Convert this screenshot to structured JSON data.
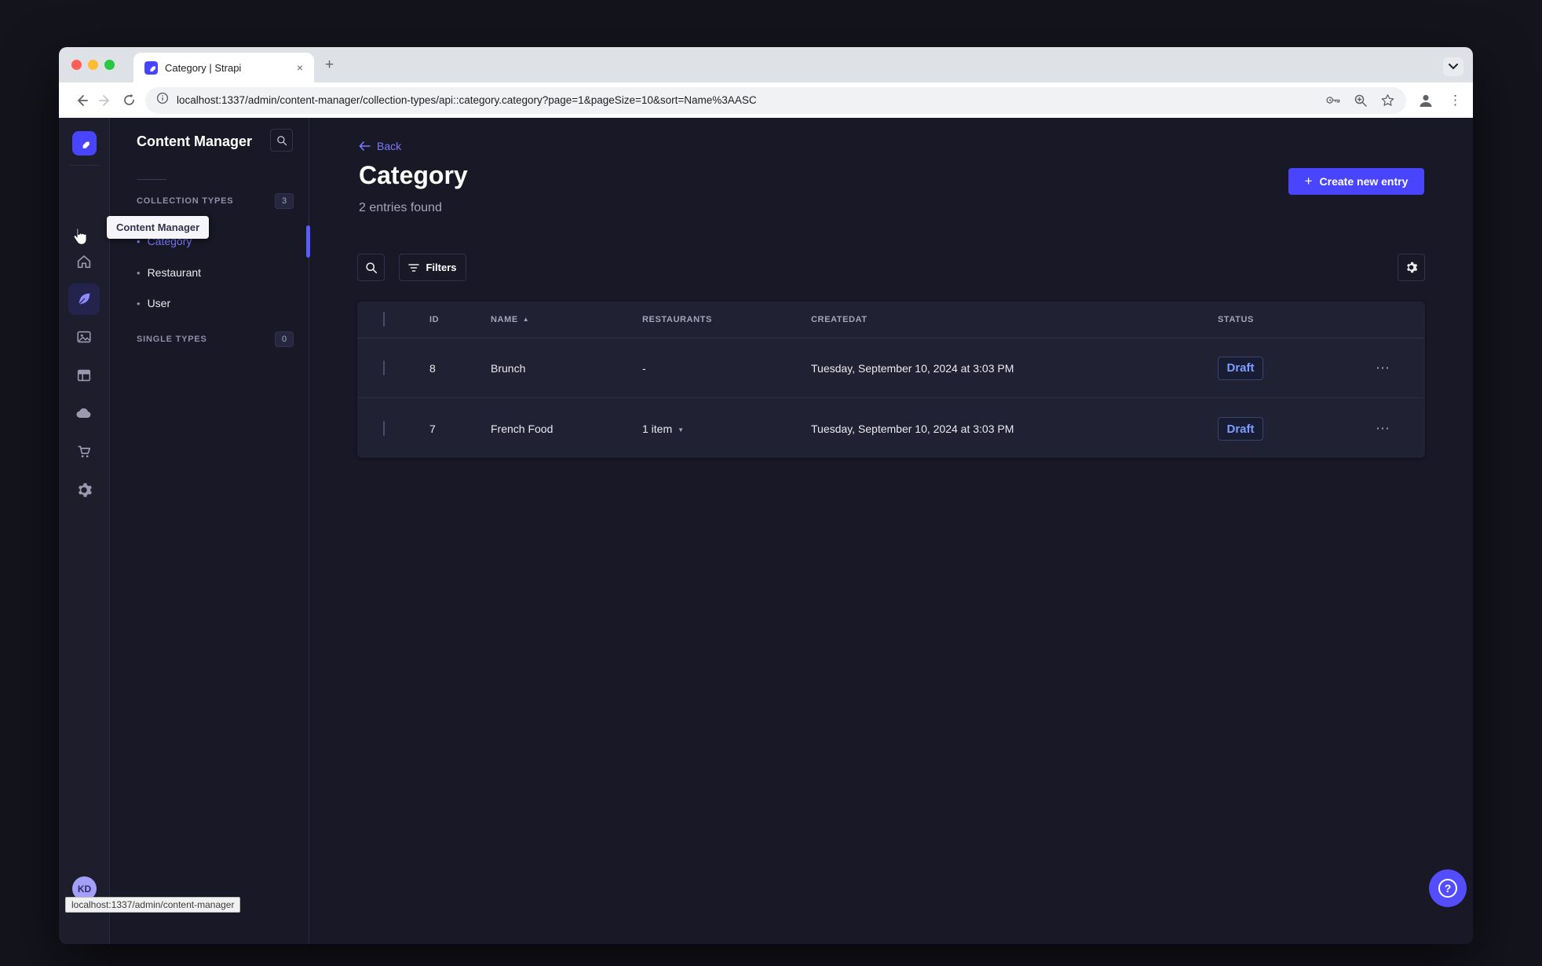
{
  "colors": {
    "primary": "#4945ff",
    "active_link": "#7b79ff",
    "draft_text": "#7f9cff"
  },
  "icons": {
    "plus": "+",
    "close": "×",
    "bullet": "•",
    "sort_asc": "▲",
    "caret_down": "▼",
    "more": "⋯",
    "menu": "⋮",
    "question": "?"
  },
  "browser": {
    "tab_title": "Category | Strapi",
    "url": "localhost:1337/admin/content-manager/collection-types/api::category.category?page=1&pageSize=10&sort=Name%3AASC",
    "status_tooltip": "localhost:1337/admin/content-manager"
  },
  "sidebar": {
    "avatar_initials": "KD",
    "tooltip": "Content Manager"
  },
  "subnav": {
    "title": "Content Manager",
    "collection_types": {
      "label": "COLLECTION TYPES",
      "count": "3",
      "items": [
        {
          "label": "Category"
        },
        {
          "label": "Restaurant"
        },
        {
          "label": "User"
        }
      ]
    },
    "single_types": {
      "label": "SINGLE TYPES",
      "count": "0"
    }
  },
  "main": {
    "back_label": "Back",
    "title": "Category",
    "entries_count": "2 entries found",
    "create_button_label": "Create new entry",
    "filters_button_label": "Filters",
    "table": {
      "headers": {
        "id": "ID",
        "name": "NAME",
        "restaurants": "RESTAURANTS",
        "createdat": "CREATEDAT",
        "status": "STATUS"
      },
      "rows": [
        {
          "id": "8",
          "name": "Brunch",
          "restaurants": "-",
          "createdat": "Tuesday, September 10, 2024 at 3:03 PM",
          "status": "Draft"
        },
        {
          "id": "7",
          "name": "French Food",
          "restaurants": "1 item",
          "createdat": "Tuesday, September 10, 2024 at 3:03 PM",
          "status": "Draft"
        }
      ]
    }
  }
}
